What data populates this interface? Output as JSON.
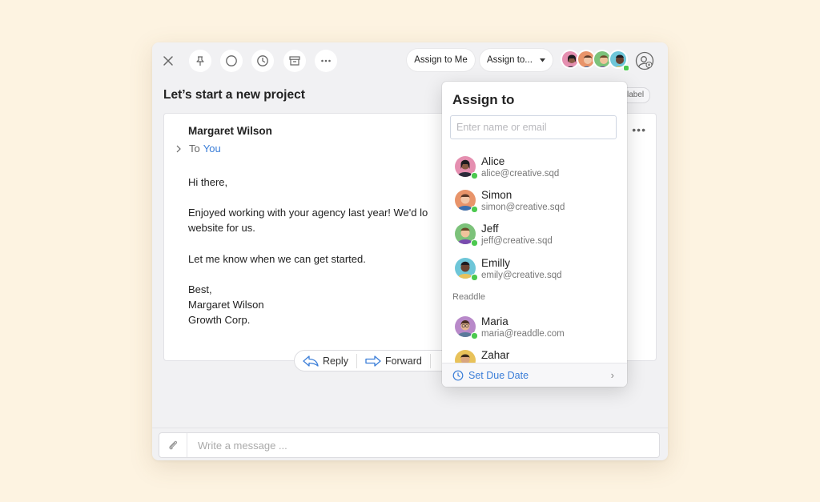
{
  "toolbar": {
    "close_icon": "close-icon",
    "pin_icon": "pin-icon",
    "done_icon": "circle-icon",
    "snooze_icon": "clock-icon",
    "archive_icon": "archive-icon",
    "more_icon": "more-icon",
    "assign_to_me_label": "Assign to Me",
    "assign_to_label": "Assign to...",
    "add_person_icon": "add-person-icon"
  },
  "email": {
    "subject": "Let’s start a new project",
    "label_chip": "label",
    "sender": "Margaret Wilson",
    "to_prefix": "To",
    "to_recipient": "You",
    "body_lines": [
      "Hi there,",
      "Enjoyed working with your agency last year! We'd lo",
      "website for us.",
      "Let me know when we can get started.",
      "Best,",
      "Margaret Wilson",
      "Growth Corp."
    ]
  },
  "reply_bar": {
    "reply_label": "Reply",
    "forward_label": "Forward"
  },
  "composer": {
    "placeholder": "Write a message ..."
  },
  "assign_popup": {
    "title": "Assign to",
    "search_placeholder": "Enter name or email",
    "people": [
      {
        "name": "Alice",
        "email": "alice@creative.sqd",
        "color": "#e58fb0"
      },
      {
        "name": "Simon",
        "email": "simon@creative.sqd",
        "color": "#e8946a"
      },
      {
        "name": "Jeff",
        "email": "jeff@creative.sqd",
        "color": "#7cc27a"
      },
      {
        "name": "Emilly",
        "email": "emily@creative.sqd",
        "color": "#6ec6d8"
      }
    ],
    "section_label": "Readdle",
    "readdle_people": [
      {
        "name": "Maria",
        "email": "maria@readdle.com",
        "color": "#b889c9"
      },
      {
        "name": "Zahar",
        "email": "",
        "color": "#e8c25a"
      }
    ],
    "footer_label": "Set Due Date"
  },
  "colors": {
    "accent": "#3b7ed8",
    "online": "#4cc94f",
    "background": "#fdf3e1"
  }
}
